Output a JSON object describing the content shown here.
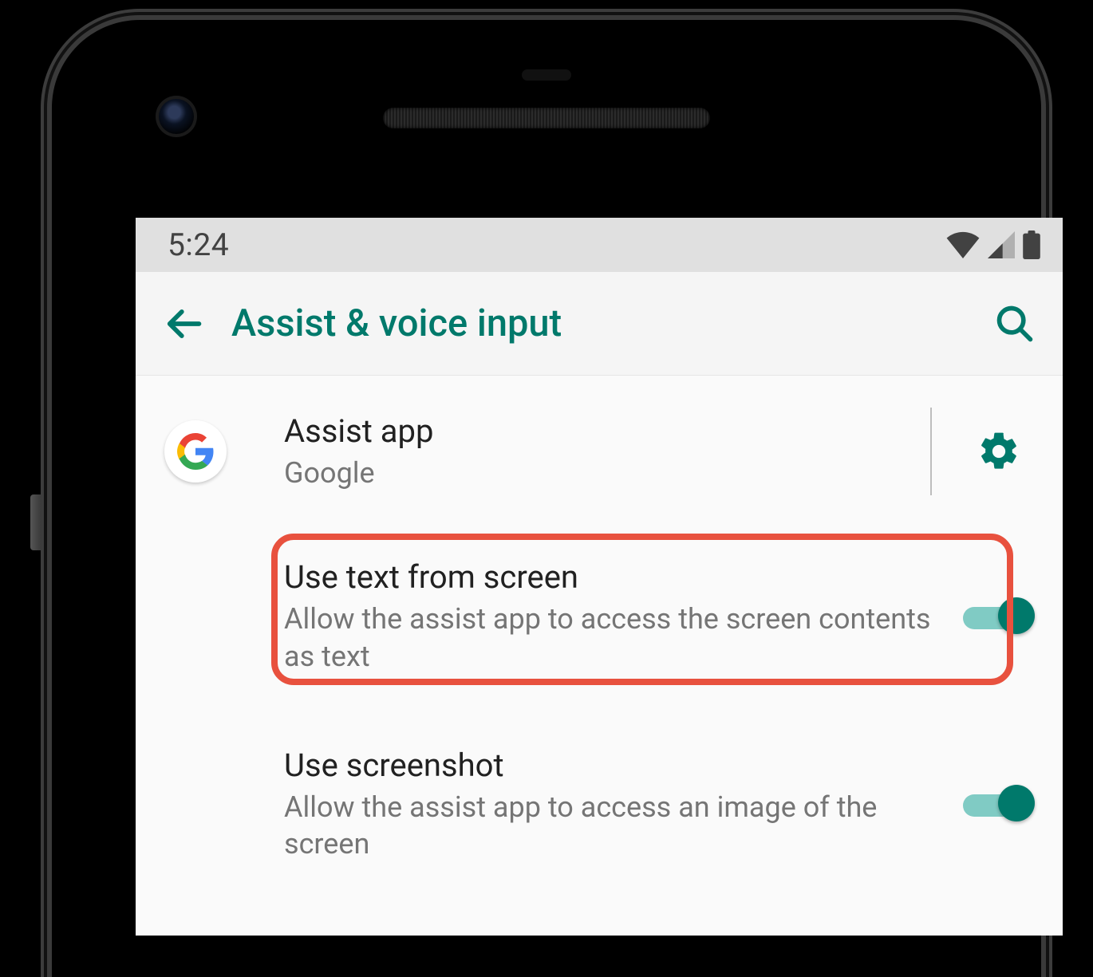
{
  "status": {
    "time": "5:24"
  },
  "appbar": {
    "title": "Assist & voice input"
  },
  "rows": {
    "assist": {
      "title": "Assist app",
      "subtitle": "Google"
    },
    "use_text": {
      "title": "Use text from screen",
      "subtitle": "Allow the assist app to access the screen contents as text",
      "enabled": true
    },
    "use_screenshot": {
      "title": "Use screenshot",
      "subtitle": "Allow the assist app to access an image of the screen",
      "enabled": true
    }
  },
  "colors": {
    "accent": "#00796b"
  }
}
